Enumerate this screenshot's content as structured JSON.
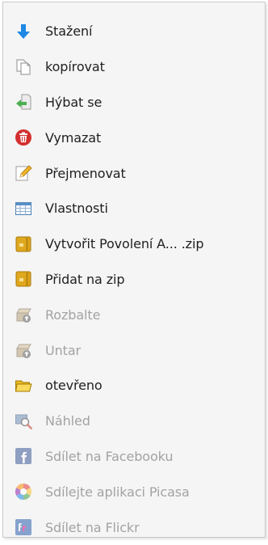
{
  "menu": {
    "items": [
      {
        "label": "Stažení",
        "icon": "download-arrow-icon",
        "enabled": true
      },
      {
        "label": "kopírovat",
        "icon": "copy-icon",
        "enabled": true
      },
      {
        "label": "Hýbat se",
        "icon": "move-icon",
        "enabled": true
      },
      {
        "label": "Vymazat",
        "icon": "trash-icon",
        "enabled": true
      },
      {
        "label": "Přejmenovat",
        "icon": "pencil-icon",
        "enabled": true
      },
      {
        "label": "Vlastnosti",
        "icon": "properties-table-icon",
        "enabled": true
      },
      {
        "label": "Vytvořit  Povolení A...  .zip",
        "icon": "zip-archive-icon",
        "enabled": true
      },
      {
        "label": "Přidat na zip",
        "icon": "zip-archive-icon",
        "enabled": true
      },
      {
        "label": "Rozbalte",
        "icon": "unpack-box-icon",
        "enabled": false
      },
      {
        "label": "Untar",
        "icon": "unpack-box-icon",
        "enabled": false
      },
      {
        "label": "otevřeno",
        "icon": "folder-open-icon",
        "enabled": true
      },
      {
        "label": "Náhled",
        "icon": "preview-icon",
        "enabled": false
      },
      {
        "label": "Sdílet na Facebooku",
        "icon": "facebook-icon",
        "enabled": false
      },
      {
        "label": "Sdílejte aplikaci Picasa",
        "icon": "picasa-icon",
        "enabled": false
      },
      {
        "label": "Sdílet na Flickr",
        "icon": "flickr-icon",
        "enabled": false
      }
    ]
  },
  "colors": {
    "download_blue": "#1e88e5",
    "trash_red": "#d32f2f",
    "zip_gold": "#e0a81e",
    "move_green": "#4caf50",
    "facebook_blue": "#3b5998",
    "disabled_text": "#a3a3a3",
    "text": "#1f1f1f"
  }
}
